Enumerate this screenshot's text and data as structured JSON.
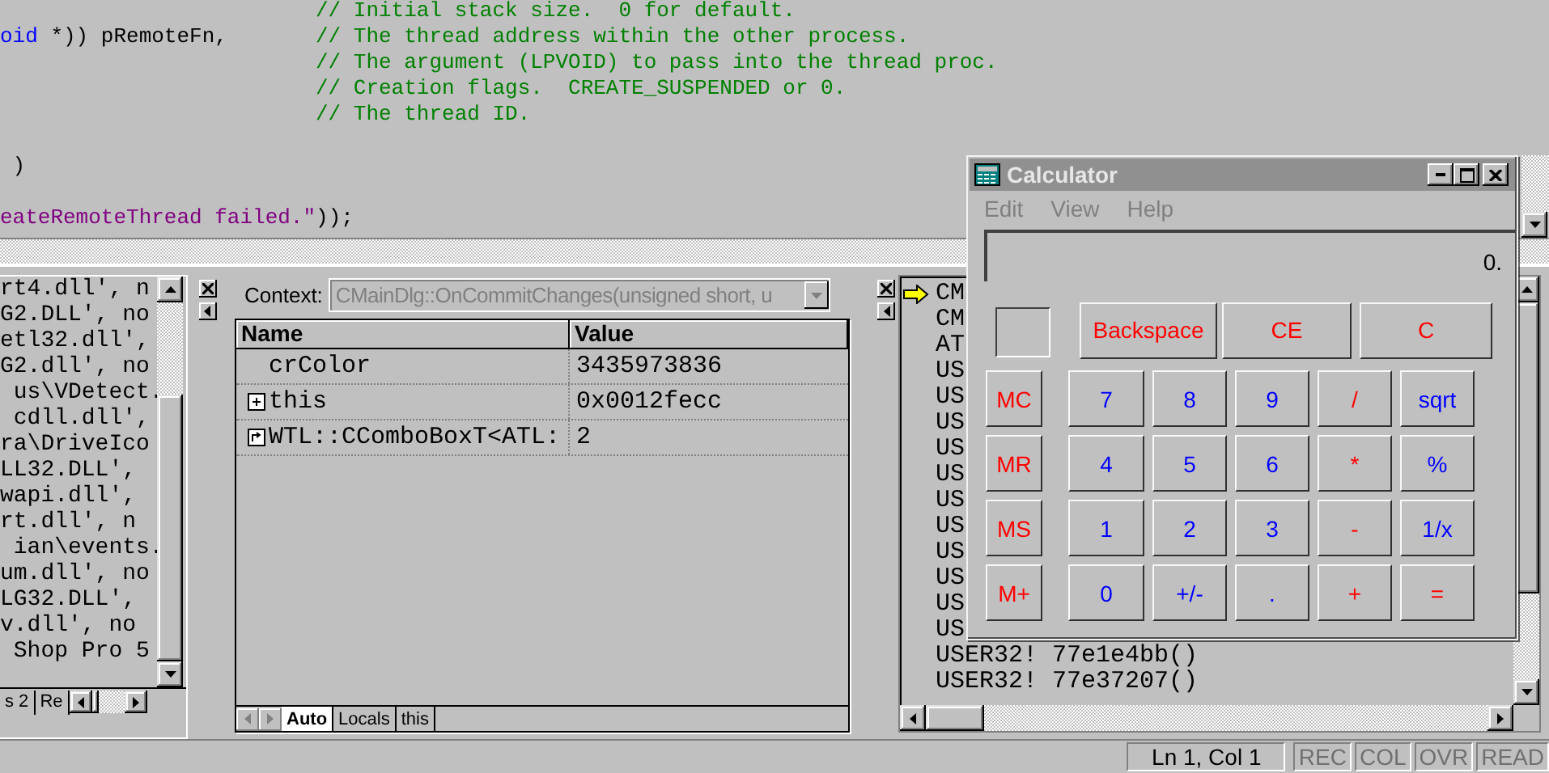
{
  "editor": {
    "lines": [
      {
        "comment": "// Initial stack size.  0 for default."
      },
      {
        "code": [
          {
            "kind": "keyword",
            "text": "oid"
          },
          {
            "kind": "plain",
            "text": " *)) pRemoteFn,"
          }
        ],
        "comment": "// The thread address within the other process."
      },
      {
        "comment": "// The argument (LPVOID) to pass into the thread proc."
      },
      {
        "comment": "// Creation flags.  CREATE_SUSPENDED or 0."
      },
      {
        "comment": "// The thread ID."
      },
      {
        "blank_before": true,
        "code": [
          {
            "kind": "plain",
            "text": " )"
          }
        ]
      },
      {
        "blank_before": true,
        "code": [
          {
            "kind": "string",
            "text": "eateRemoteThread failed.\""
          },
          {
            "kind": "plain",
            "text": "));"
          }
        ]
      }
    ]
  },
  "output": {
    "lines": [
      "rt4.dll', n",
      "G2.DLL', no",
      "etl32.dll',",
      "G2.dll', no",
      " us\\VDetect.",
      " cdll.dll',",
      "ra\\DriveIco",
      "LL32.DLL',",
      "wapi.dll',",
      "rt.dll', n",
      " ian\\events.",
      "um.dll', no",
      "LG32.DLL',",
      "v.dll', no",
      " Shop Pro 5"
    ],
    "tabs": [
      {
        "label": "s 2",
        "selected": false
      },
      {
        "label": "Re",
        "selected": false
      }
    ]
  },
  "variables": {
    "context_label": "Context:",
    "context_value": "CMainDlg::OnCommitChanges(unsigned short, u",
    "columns": [
      "Name",
      "Value"
    ],
    "rows": [
      {
        "kind": "plain",
        "name": "crColor",
        "value": "3435973836"
      },
      {
        "kind": "expandable",
        "name": "this",
        "value": "0x0012fecc"
      },
      {
        "kind": "return",
        "name": "WTL::CComboBoxT<ATL:",
        "value": "2"
      }
    ],
    "tabs": [
      {
        "label": "Auto",
        "selected": true
      },
      {
        "label": "Locals",
        "selected": false
      },
      {
        "label": "this",
        "selected": false
      }
    ]
  },
  "call_stack": {
    "frames": [
      {
        "text": "CM",
        "current": true
      },
      {
        "text": "CM",
        "current": false
      },
      {
        "text": "AT",
        "current": false
      },
      {
        "text": "US",
        "current": false
      },
      {
        "text": "US",
        "current": false
      },
      {
        "text": "US",
        "current": false
      },
      {
        "text": "US",
        "current": false
      },
      {
        "text": "US",
        "current": false
      },
      {
        "text": "US",
        "current": false
      },
      {
        "text": "US",
        "current": false
      },
      {
        "text": "US",
        "current": false
      },
      {
        "text": "US",
        "current": false
      },
      {
        "text": "US",
        "current": false
      },
      {
        "text": "US",
        "current": false
      },
      {
        "text": "USER32! 77e1e4bb()",
        "current": false
      },
      {
        "text": "USER32! 77e37207()",
        "current": false
      }
    ]
  },
  "calculator": {
    "title": "Calculator",
    "menu": [
      "Edit",
      "View",
      "Help"
    ],
    "display": "0.",
    "top_keys": [
      {
        "label": "Backspace",
        "color": "#ff0000"
      },
      {
        "label": "CE",
        "color": "#ff0000"
      },
      {
        "label": "C",
        "color": "#ff0000"
      }
    ],
    "keys": [
      [
        {
          "label": "MC",
          "color": "#ff0000"
        },
        {
          "label": "7",
          "color": "#0000ff"
        },
        {
          "label": "8",
          "color": "#0000ff"
        },
        {
          "label": "9",
          "color": "#0000ff"
        },
        {
          "label": "/",
          "color": "#ff0000"
        },
        {
          "label": "sqrt",
          "color": "#0000ff"
        }
      ],
      [
        {
          "label": "MR",
          "color": "#ff0000"
        },
        {
          "label": "4",
          "color": "#0000ff"
        },
        {
          "label": "5",
          "color": "#0000ff"
        },
        {
          "label": "6",
          "color": "#0000ff"
        },
        {
          "label": "*",
          "color": "#ff0000"
        },
        {
          "label": "%",
          "color": "#0000ff"
        }
      ],
      [
        {
          "label": "MS",
          "color": "#ff0000"
        },
        {
          "label": "1",
          "color": "#0000ff"
        },
        {
          "label": "2",
          "color": "#0000ff"
        },
        {
          "label": "3",
          "color": "#0000ff"
        },
        {
          "label": "-",
          "color": "#ff0000"
        },
        {
          "label": "1/x",
          "color": "#0000ff"
        }
      ],
      [
        {
          "label": "M+",
          "color": "#ff0000"
        },
        {
          "label": "0",
          "color": "#0000ff"
        },
        {
          "label": "+/-",
          "color": "#0000ff"
        },
        {
          "label": ".",
          "color": "#0000ff"
        },
        {
          "label": "+",
          "color": "#ff0000"
        },
        {
          "label": "=",
          "color": "#ff0000"
        }
      ]
    ]
  },
  "status_bar": {
    "position": "Ln 1, Col 1",
    "indicators": [
      {
        "label": "REC",
        "on": false
      },
      {
        "label": "COL",
        "on": false
      },
      {
        "label": "OVR",
        "on": false
      },
      {
        "label": "READ",
        "on": false
      }
    ]
  }
}
